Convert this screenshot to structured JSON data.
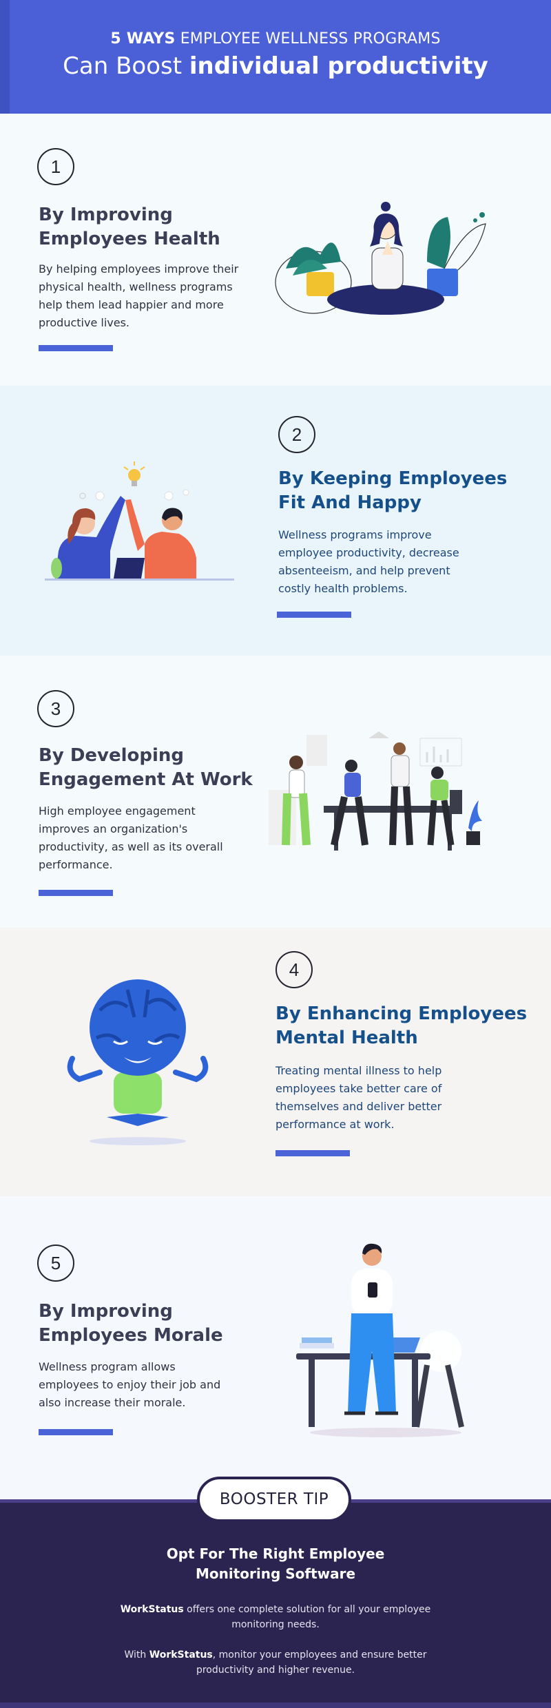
{
  "header": {
    "line1_bold": "5 WAYS",
    "line1_rest": " EMPLOYEE WELLNESS PROGRAMS",
    "line2_plain": "Can Boost ",
    "line2_bold": "individual productivity"
  },
  "sections": [
    {
      "number": "1",
      "title_1": "By Improving",
      "title_2": "Employees Health",
      "desc_lines": [
        "By helping employees improve their",
        "physical health, wellness programs",
        "help them lead happier and more",
        "productive lives."
      ]
    },
    {
      "number": "2",
      "title_1": "By Keeping Employees",
      "title_2": "Fit And Happy",
      "desc_lines": [
        "Wellness programs improve",
        "employee productivity, decrease",
        "absenteeism, and help prevent",
        "costly health problems."
      ]
    },
    {
      "number": "3",
      "title_1": "By Developing",
      "title_2": "Engagement At Work",
      "desc_lines": [
        "High employee engagement",
        "improves an organization's",
        "productivity, as well as its overall",
        "performance."
      ]
    },
    {
      "number": "4",
      "title_1": "By Enhancing Employees",
      "title_2": "Mental Health",
      "desc_lines": [
        "Treating mental illness to help",
        "employees take better care of",
        "themselves and deliver better",
        "performance at work."
      ]
    },
    {
      "number": "5",
      "title_1": "By Improving",
      "title_2": "Employees Morale",
      "desc_lines": [
        "Wellness program allows",
        "employees to enjoy their job and",
        "also increase their morale."
      ]
    }
  ],
  "booster": {
    "label": "BOOSTER TIP",
    "title_1": "Opt For The Right Employee",
    "title_2": "Monitoring Software",
    "p1_bold": "WorkStatus",
    "p1_line1": " offers one complete solution for all your employee",
    "p1_line2": "monitoring needs.",
    "p2_prefix": "With ",
    "p2_bold": "WorkStatus",
    "p2_line1": ", monitor your employees and ensure better",
    "p2_line2": "productivity and higher revenue."
  },
  "colors": {
    "header_bg": "#4b60d6",
    "accent_bar": "#4a63d6",
    "footer_bg": "#2b2350",
    "title_dark": "#3c3e55",
    "title_blue": "#15508a"
  }
}
